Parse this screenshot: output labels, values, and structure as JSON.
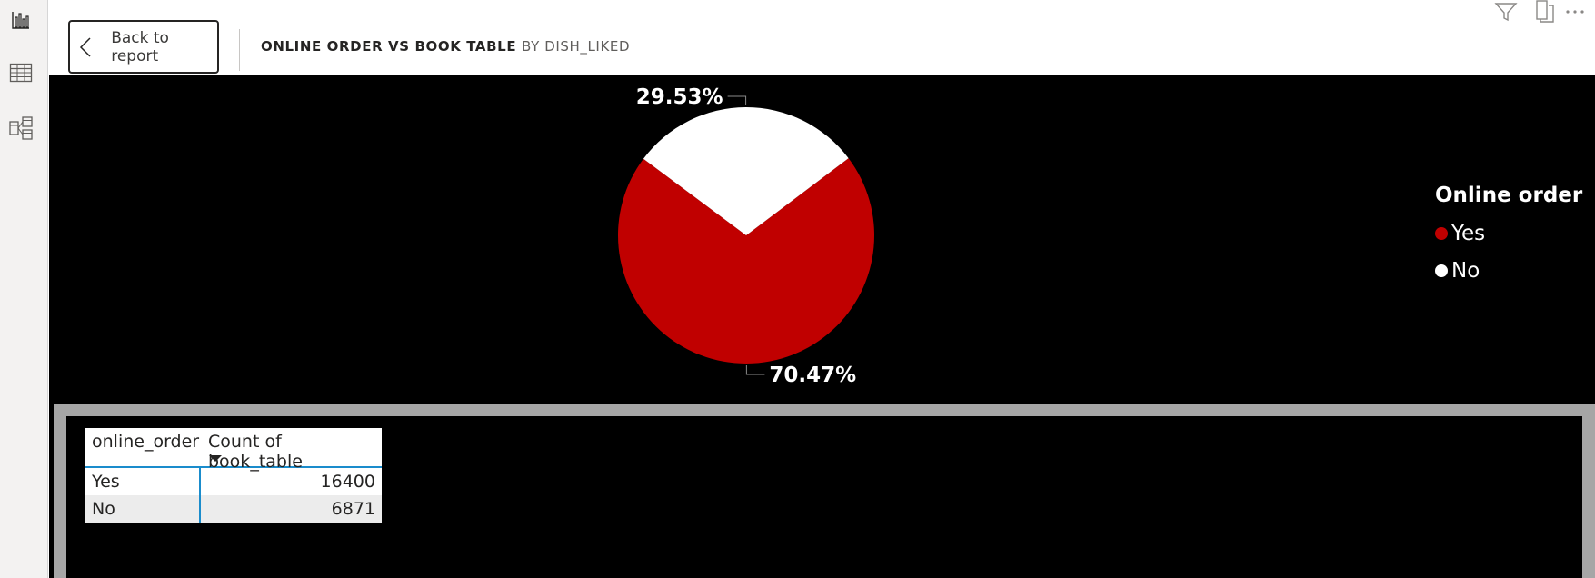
{
  "header": {
    "back_label": "Back to report",
    "title": "ONLINE ORDER VS BOOK TABLE",
    "subtitle": "BY DISH_LIKED"
  },
  "rail": {
    "items": [
      {
        "icon": "report-view-icon"
      },
      {
        "icon": "data-view-icon"
      },
      {
        "icon": "model-view-icon"
      }
    ]
  },
  "toolbar": {
    "icons": [
      "filter-icon",
      "focus-mode-icon",
      "more-options-icon"
    ]
  },
  "chart_data": {
    "type": "pie",
    "legend_title": "Online order",
    "legend_position": "right",
    "slices": [
      {
        "label": "Yes",
        "percent": 70.47,
        "percent_label": "70.47%",
        "color": "#c00000"
      },
      {
        "label": "No",
        "percent": 29.53,
        "percent_label": "29.53%",
        "color": "#ffffff"
      }
    ]
  },
  "table": {
    "columns": [
      "online_order",
      "Count of book_table"
    ],
    "rows": [
      {
        "online_order": "Yes",
        "count": "16400"
      },
      {
        "online_order": "No",
        "count": "6871"
      }
    ]
  },
  "colors": {
    "yes": "#c00000",
    "no": "#ffffff",
    "canvas": "#000000",
    "table_accent": "#1a8ccc"
  }
}
